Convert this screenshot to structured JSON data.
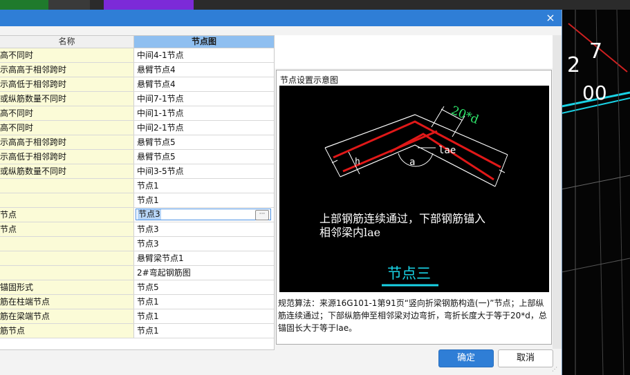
{
  "dialog": {
    "close_icon": "×",
    "colors": {
      "titlebar": "#2f7ed6",
      "header_selected": "#8fbff0",
      "name_cell_bg": "#fbfbd7"
    }
  },
  "grid": {
    "headers": {
      "name": "名称",
      "node": "节点图"
    },
    "rows": [
      {
        "name": "高不同时",
        "node": "中间4-1节点"
      },
      {
        "name": "示高高于相邻跨时",
        "node": "悬臂节点4"
      },
      {
        "name": "示高低于相邻跨时",
        "node": "悬臂节点4"
      },
      {
        "name": "或纵筋数量不同时",
        "node": "中间7-1节点"
      },
      {
        "name": "高不同时",
        "node": "中间1-1节点"
      },
      {
        "name": "高不同时",
        "node": "中间2-1节点"
      },
      {
        "name": "示高高于相邻跨时",
        "node": "悬臂节点5"
      },
      {
        "name": "示高低于相邻跨时",
        "node": "悬臂节点5"
      },
      {
        "name": "或纵筋数量不同时",
        "node": "中间3-5节点"
      },
      {
        "name": "",
        "node": "节点1"
      },
      {
        "name": "",
        "node": "节点1"
      },
      {
        "name": "节点",
        "node": "节点3"
      },
      {
        "name": "节点",
        "node": "节点3"
      },
      {
        "name": "",
        "node": "节点3"
      },
      {
        "name": "",
        "node": "悬臂梁节点1"
      },
      {
        "name": "",
        "node": "2#弯起钢筋图"
      },
      {
        "name": "锚固形式",
        "node": "节点5"
      },
      {
        "name": "筋在柱端节点",
        "node": "节点1"
      },
      {
        "name": "筋在梁端节点",
        "node": "节点1"
      },
      {
        "name": "筋节点",
        "node": "节点1"
      }
    ],
    "editing_row_index": 11,
    "ellipsis_label": "···"
  },
  "preview": {
    "group_title": "节点设置示意图",
    "diagram": {
      "dim_label": "20*d",
      "angle_label": "a",
      "h_label": "h",
      "lae_label": "lae",
      "desc_line1": "上部钢筋连续通过，下部钢筋锚入",
      "desc_line2": "相邻梁内lae",
      "node_title": "节点三"
    },
    "rule_text": "规范算法：来源16G101-1第91页“竖向折梁钢筋构造(一)”节点；上部纵筋连续通过；下部纵筋伸至相邻梁对边弯折，弯折长度大于等于20*d，总锚固长大于等于lae。"
  },
  "buttons": {
    "ok": "确定",
    "cancel": "取消"
  }
}
